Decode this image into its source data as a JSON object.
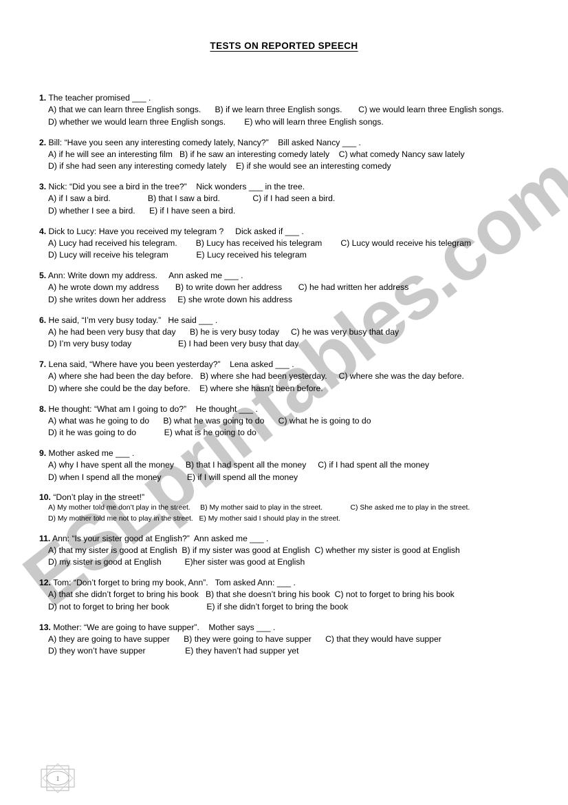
{
  "document": {
    "title": "TESTS ON REPORTED SPEECH",
    "watermark": "ESLprintables.com",
    "watermark_color": "#c9c9c9",
    "page_number": "1",
    "background_color": "#ffffff",
    "text_color": "#000000"
  },
  "questions": [
    {
      "number": "1.",
      "stem": " The teacher promised ___ .",
      "lines": [
        "A) that we can learn three English songs.      B) if we learn three English songs.       C) we would learn three English songs.",
        "D) whether we would learn three English songs.        E) who will learn three English songs."
      ]
    },
    {
      "number": "2.",
      "stem": " Bill: “Have you seen any interesting comedy lately, Nancy?”    Bill asked Nancy ___ .",
      "lines": [
        "A) if he will see an interesting film   B) if he saw an interesting comedy lately    C) what comedy Nancy saw lately",
        "D) if she had seen any interesting comedy lately    E) if she would see an interesting comedy"
      ]
    },
    {
      "number": "3.",
      "stem": " Nick: “Did you see a bird in the tree?”    Nick wonders ___ in the tree.",
      "lines": [
        "A) if I saw a bird.                B) that I saw a bird.              C) if I had seen a bird.",
        "D) whether I see a bird.      E) if I have seen a bird."
      ]
    },
    {
      "number": "4.",
      "stem": " Dick to Lucy: Have you received my telegram ?     Dick asked if ___ .",
      "lines": [
        "A) Lucy had received his telegram.        B) Lucy has received his telegram        C) Lucy would receive his telegram",
        "D) Lucy will receive his telegram            E) Lucy received his telegram"
      ]
    },
    {
      "number": "5.",
      "stem": " Ann: Write down my address.     Ann asked me ___ .",
      "lines": [
        "A) he wrote down my address       B) to write down her address       C) he had written her address",
        "D) she writes down her address     E) she wrote down his address"
      ]
    },
    {
      "number": "6.",
      "stem": " He said, “I’m very busy today.”   He said ___ .",
      "lines": [
        "A) he had been very busy that day      B) he is very busy today     C) he was very busy that day",
        "D) I’m very busy today                    E) I had been very busy that day"
      ]
    },
    {
      "number": "7.",
      "stem": " Lena said, “Where have you been yesterday?”    Lena asked ___ .",
      "lines": [
        "A) where she had been the day before.   B) where she had been yesterday.     C) where she was the day before.",
        "D) where she could be the day before.    E) where she hasn’t been before."
      ]
    },
    {
      "number": "8.",
      "stem": " He thought: “What am I going to do?”    He thought ___ .",
      "lines": [
        "A) what was he going to do      B) what he was going to do      C) what he is going to do",
        "D) it he was going to do            E) what is he going to do"
      ]
    },
    {
      "number": "9.",
      "stem": " Mother asked me ___ .",
      "lines": [
        "A) why I have spent all the money     B) that I had spent all the money     C) if I had spent all the money",
        "D) when I spend all the money           E) if I will spend all the money"
      ]
    },
    {
      "number": "10.",
      "stem": " “Don’t play in the street!”",
      "small": true,
      "lines": [
        "A) My mother told me don’t play in the street.     B) My mother said to play in the street.              C) She asked me to play in the street.",
        "D) My mother told me not to play in the street.   E) My mother said I should play in the street."
      ]
    },
    {
      "number": "11.",
      "stem": " Ann: “Is your sister good at English?”  Ann asked me ___ .",
      "lines": [
        "A) that my sister is good at English  B) if my sister was good at English  C) whether my sister is good at English",
        "D) my sister is good at English          E)her sister was good at English"
      ]
    },
    {
      "number": "12.",
      "stem": " Tom: “Don’t forget to bring my book, Ann”.   Tom asked Ann: ___ .",
      "lines": [
        "A) that she didn’t forget to bring his book   B) that she doesn’t bring his book  C) not to forget to bring his book",
        "D) not to forget to bring her book                E) if she didn’t forget to bring the book"
      ]
    },
    {
      "number": "13.",
      "stem": " Mother: “We are going to have supper”.    Mother says ___ .",
      "lines": [
        "A) they are going to have supper      B) they were going to have supper      C) that they would have supper",
        "D) they won’t have supper                 E) they haven’t had supper yet"
      ]
    }
  ]
}
